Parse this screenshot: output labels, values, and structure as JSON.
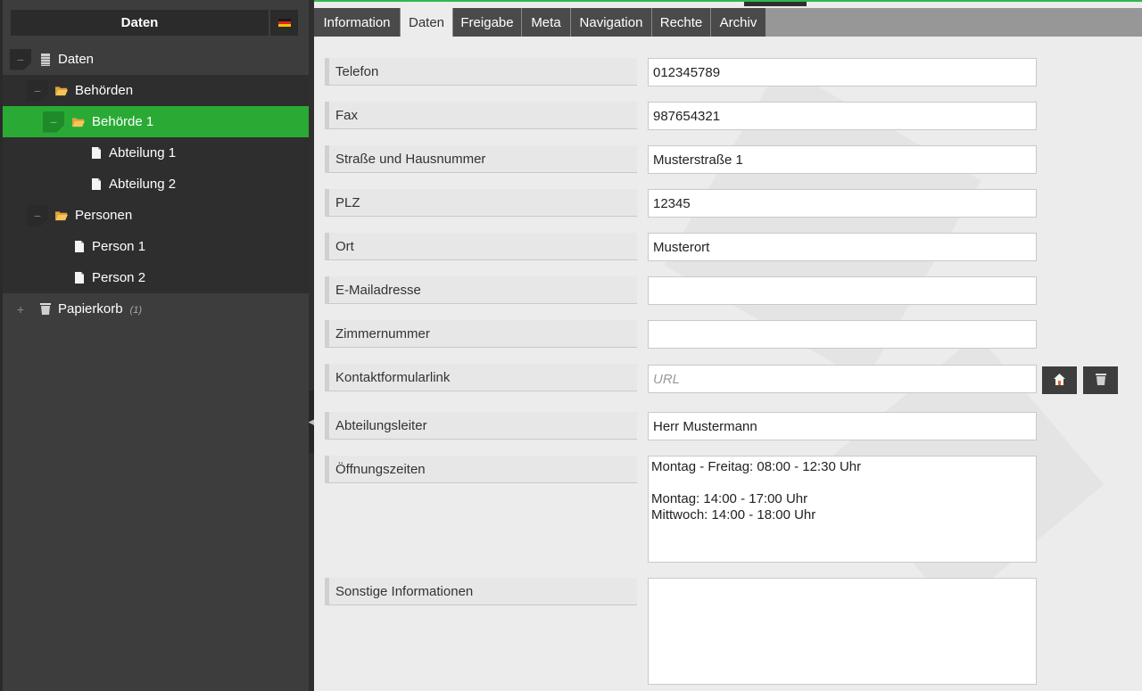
{
  "tree": {
    "header": "Daten",
    "language_flag": "de-flag",
    "nodes": [
      {
        "label": "Daten",
        "icon": "database-icon",
        "toggle": "−"
      },
      {
        "label": "Behörden",
        "icon": "folder-open-icon",
        "toggle": "−"
      },
      {
        "label": "Behörde 1",
        "icon": "folder-open-icon",
        "toggle": "−"
      },
      {
        "label": "Abteilung 1",
        "icon": "document-icon"
      },
      {
        "label": "Abteilung 2",
        "icon": "document-icon"
      },
      {
        "label": "Personen",
        "icon": "folder-open-icon",
        "toggle": "−"
      },
      {
        "label": "Person 1",
        "icon": "document-icon"
      },
      {
        "label": "Person 2",
        "icon": "document-icon"
      },
      {
        "label": "Papierkorb",
        "icon": "trash-icon",
        "toggle": "+",
        "count": "(1)"
      }
    ]
  },
  "tabs": [
    {
      "label": "Information"
    },
    {
      "label": "Daten",
      "active": true
    },
    {
      "label": "Freigabe"
    },
    {
      "label": "Meta"
    },
    {
      "label": "Navigation"
    },
    {
      "label": "Rechte"
    },
    {
      "label": "Archiv"
    }
  ],
  "form": {
    "telefon": {
      "label": "Telefon",
      "value": "012345789"
    },
    "fax": {
      "label": "Fax",
      "value": "987654321"
    },
    "strasse": {
      "label": "Straße und Hausnummer",
      "value": "Musterstraße 1"
    },
    "plz": {
      "label": "PLZ",
      "value": "12345"
    },
    "ort": {
      "label": "Ort",
      "value": "Musterort"
    },
    "email": {
      "label": "E-Mailadresse",
      "value": ""
    },
    "zimmer": {
      "label": "Zimmernummer",
      "value": ""
    },
    "kontakt": {
      "label": "Kontaktformularlink",
      "value": "",
      "placeholder": "URL"
    },
    "leiter": {
      "label": "Abteilungsleiter",
      "value": "Herr Mustermann"
    },
    "oeffnung": {
      "label": "Öffnungszeiten",
      "value": "Montag - Freitag: 08:00 - 12:30 Uhr\n\nMontag: 14:00 - 17:00 Uhr\nMittwoch: 14:00 - 18:00 Uhr"
    },
    "sonstige": {
      "label": "Sonstige Informationen",
      "value": ""
    }
  },
  "colors": {
    "accent": "#2aaa35",
    "sidebar": "#3d3d3d",
    "tab_active": "#ececec"
  }
}
